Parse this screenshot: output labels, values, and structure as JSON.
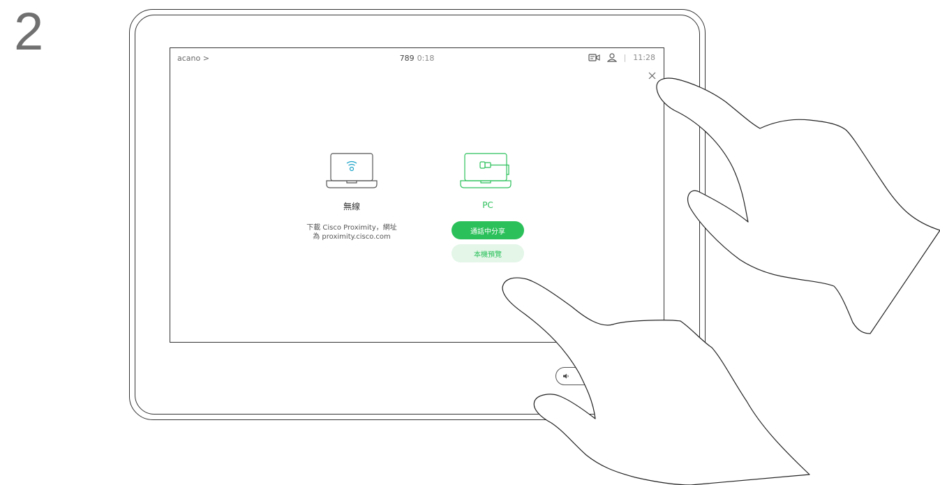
{
  "step": {
    "number": "2"
  },
  "top_bar": {
    "call_name": "acano >",
    "call_number": "789",
    "call_duration": "0:18",
    "separator": "|",
    "time": "11:28",
    "icons": [
      "presentation-icon",
      "user-icon"
    ]
  },
  "close": {
    "icon": "close-icon"
  },
  "wireless": {
    "title": "無線",
    "desc_line1": "下載 Cisco Proximity，網址",
    "desc_line2": "為 proximity.cisco.com",
    "icon": "wifi-laptop-icon",
    "color": "#1ba3c8"
  },
  "pc": {
    "title": "PC",
    "icon": "cable-laptop-icon",
    "share_label": "通話中分享",
    "preview_label": "本機預覽",
    "color": "#2bc05a"
  },
  "volume": {
    "icon": "speaker-icon"
  },
  "colors": {
    "accent": "#2bc05a",
    "accent_light": "#e3f6e8",
    "frame": "#333333"
  }
}
